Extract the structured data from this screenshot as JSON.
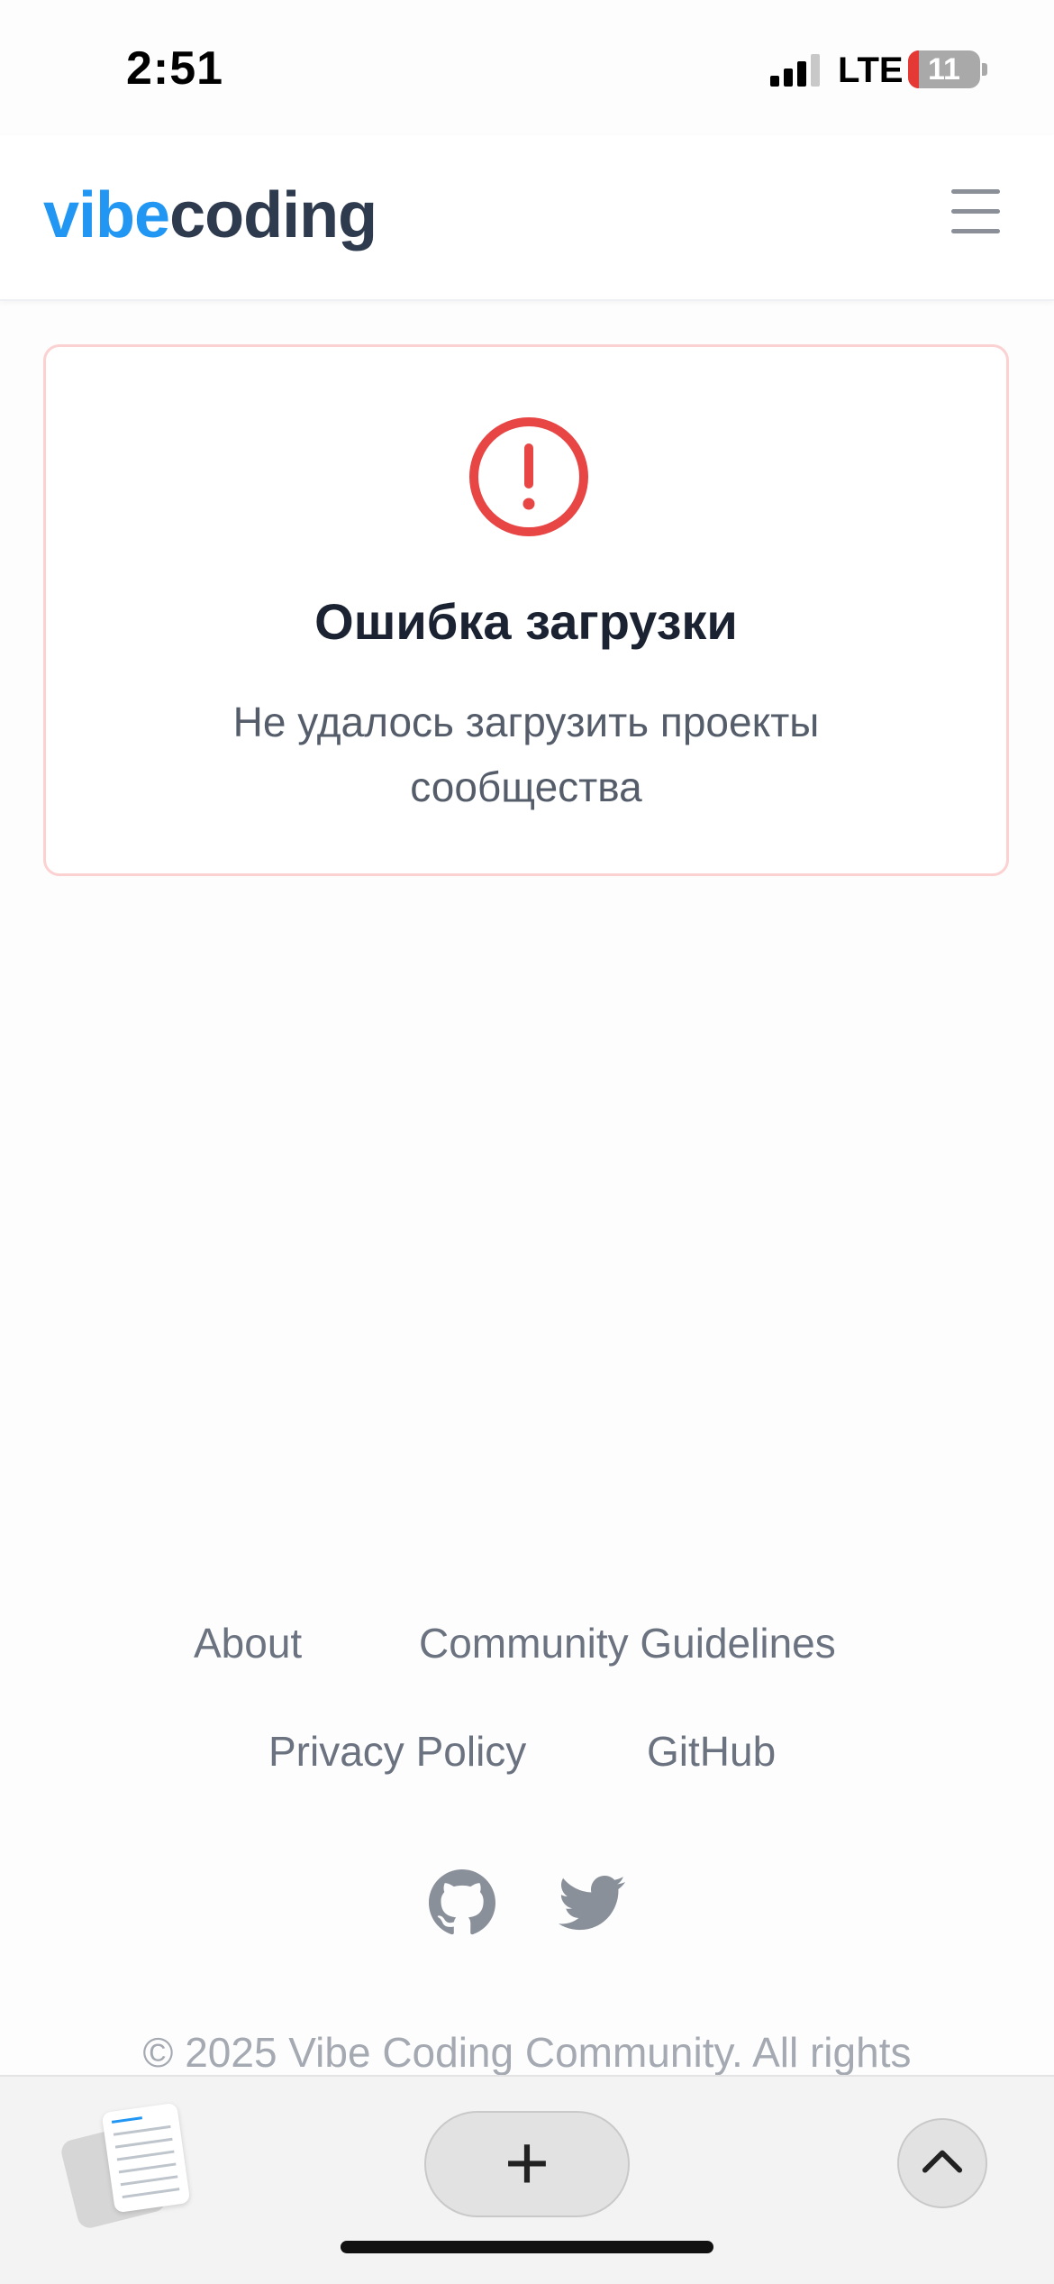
{
  "status_bar": {
    "time": "2:51",
    "network": "LTE",
    "battery": "11"
  },
  "header": {
    "logo_part1": "vibe",
    "logo_part2": "coding",
    "menu_icon": "hamburger-menu-icon",
    "colors": {
      "accent": "#2196f3",
      "dark": "#2e3a4d"
    }
  },
  "error": {
    "icon": "exclamation-circle-icon",
    "title": "Ошибка загрузки",
    "message": "Не удалось загрузить проекты сообщества",
    "colors": {
      "icon": "#e84545",
      "border": "#fbd1d1"
    }
  },
  "footer": {
    "links": [
      "About",
      "Community Guidelines",
      "Privacy Policy",
      "GitHub"
    ],
    "social": [
      "github-icon",
      "twitter-icon"
    ],
    "copyright": "© 2025 Vibe Coding Community. All rights"
  },
  "browser_toolbar": {
    "tabs_icon": "tabs-overview-icon",
    "new_tab_icon": "plus-icon",
    "scroll_top_icon": "chevron-up-icon"
  }
}
